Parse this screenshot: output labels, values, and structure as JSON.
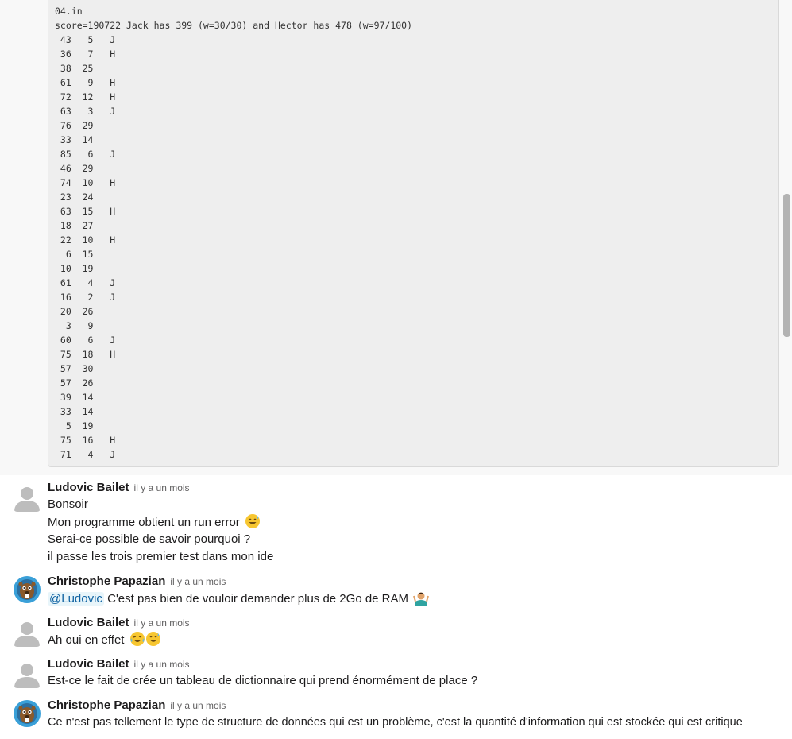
{
  "code_block": {
    "lines": [
      "04.in",
      "score=190722 Jack has 399 (w=30/30) and Hector has 478 (w=97/100)",
      " 43   5   J",
      " 36   7   H",
      " 38  25",
      " 61   9   H",
      " 72  12   H",
      " 63   3   J",
      " 76  29",
      " 33  14",
      " 85   6   J",
      " 46  29",
      " 74  10   H",
      " 23  24",
      " 63  15   H",
      " 18  27",
      " 22  10   H",
      "  6  15",
      " 10  19",
      " 61   4   J",
      " 16   2   J",
      " 20  26",
      "  3   9",
      " 60   6   J",
      " 75  18   H",
      " 57  30",
      " 57  26",
      " 39  14",
      " 33  14",
      "  5  19",
      " 75  16   H",
      " 71   4   J"
    ]
  },
  "messages": [
    {
      "author": "Ludovic Bailet",
      "time": "il y a un mois",
      "avatar": "default-user-icon",
      "lines": [
        "Bonsoir",
        "Mon programme obtient un run error",
        "Serai-ce possible de savoir pourquoi ?",
        "il passe les trois premier test dans mon ide"
      ]
    },
    {
      "author": "Christophe Papazian",
      "time": "il y a un mois",
      "avatar": "beaver-avatar-icon",
      "mention": "@Ludovic",
      "lines": [
        " C'est pas bien de vouloir demander plus de 2Go de RAM"
      ]
    },
    {
      "author": "Ludovic Bailet",
      "time": "il y a un mois",
      "avatar": "default-user-icon",
      "lines": [
        "Ah oui en effet"
      ]
    },
    {
      "author": "Ludovic Bailet",
      "time": "il y a un mois",
      "avatar": "default-user-icon",
      "lines": [
        "Est-ce le fait de crée un tableau de dictionnaire qui prend énormément de place ?"
      ]
    },
    {
      "author": "Christophe Papazian",
      "time": "il y a un mois",
      "avatar": "beaver-avatar-icon",
      "lines": [
        "Ce n'est pas tellement le type de structure de données qui est un problème, c'est la quantité d'information qui est stockée qui est critique"
      ]
    }
  ],
  "emojis": [
    "sweat-smile-emoji",
    "person-shrugging-emoji",
    "joy-emoji",
    "sweat-smile-emoji"
  ],
  "colors": {
    "mention_bg": "#e8f5fa",
    "mention_text": "#1264a3",
    "code_bg": "#eeeeee"
  }
}
